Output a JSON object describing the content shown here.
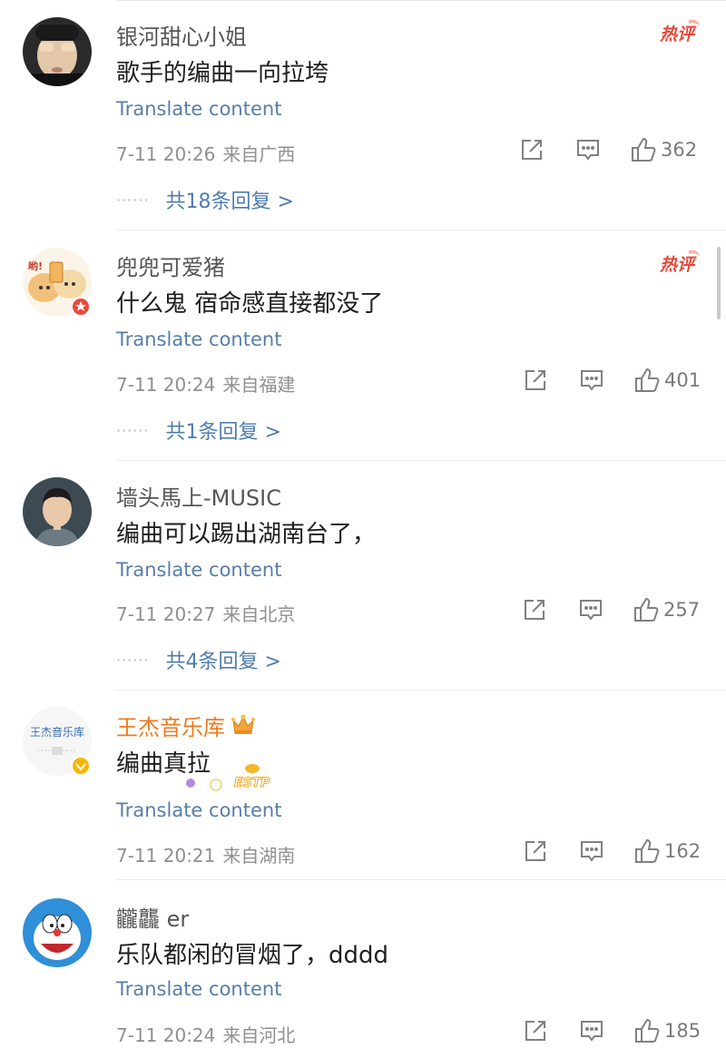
{
  "comments": [
    {
      "user": "银河甜心小姐",
      "text": "歌手的编曲一向拉垮",
      "translate": "Translate content",
      "time": "7-11 20:26",
      "location": "来自广西",
      "likes": "362",
      "hot_label": "热评",
      "replies": "共18条回复 >"
    },
    {
      "user": "兜兜可爱猪",
      "text": "什么鬼 宿命感直接都没了",
      "translate": "Translate content",
      "time": "7-11 20:24",
      "location": "来自福建",
      "likes": "401",
      "hot_label": "热评",
      "replies": "共1条回复 >"
    },
    {
      "user": "墙头馬上-MUSIC",
      "text": "编曲可以踢出湖南台了，",
      "translate": "Translate content",
      "time": "7-11 20:27",
      "location": "来自北京",
      "likes": "257",
      "replies": "共4条回复 >"
    },
    {
      "user": "王杰音乐库",
      "text": "编曲真拉",
      "translate": "Translate content",
      "time": "7-11 20:21",
      "location": "来自湖南",
      "likes": "162",
      "avatar_text": "王杰音乐库",
      "sticker_text": "ESTP"
    },
    {
      "user": "龖龘 er",
      "text": "乐队都闲的冒烟了，dddd",
      "translate": "Translate content",
      "time": "7-11 20:24",
      "location": "来自河北",
      "likes": "185"
    }
  ],
  "colors": {
    "link": "#587ea8",
    "vip_name": "#ee7a1f",
    "hot_badge": "#e8483a",
    "icon": "#808080"
  },
  "icons": [
    "repost-icon",
    "comment-icon",
    "like-icon",
    "crown-icon",
    "verified-badge-icon"
  ]
}
